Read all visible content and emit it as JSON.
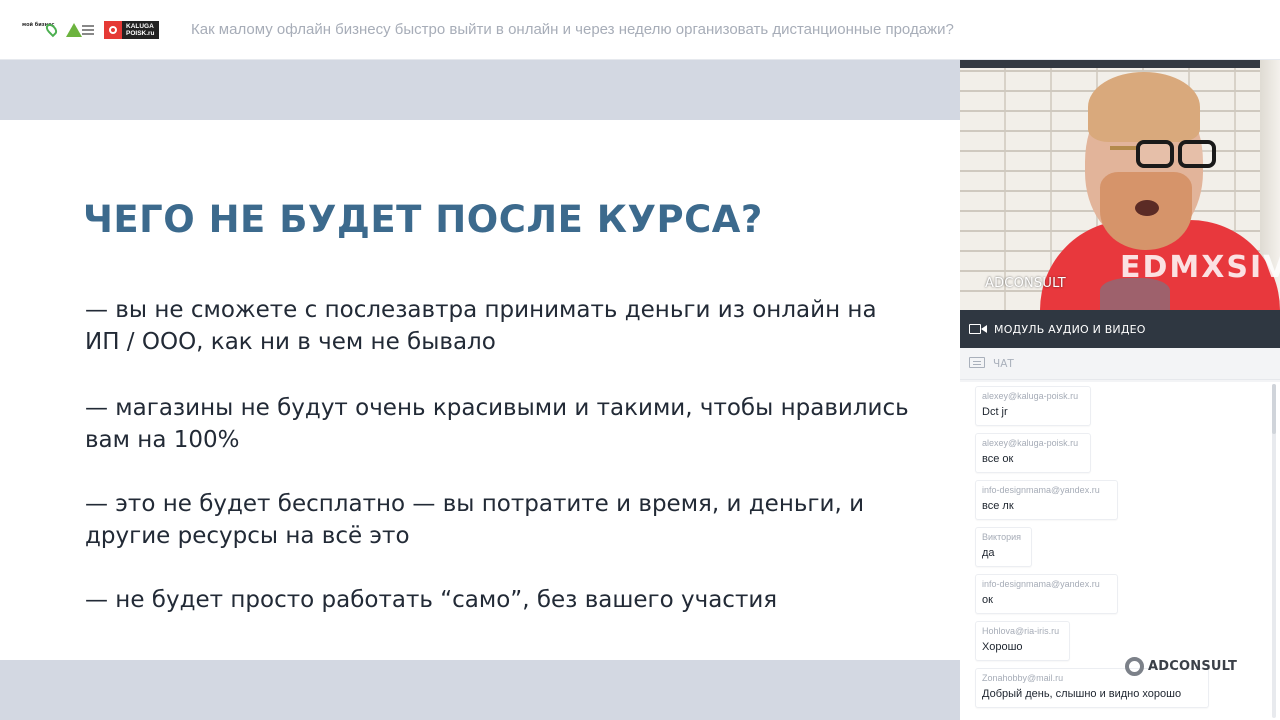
{
  "header": {
    "logos": {
      "moy_biznes": "мой бизнес",
      "kaluga_line1": "KALUGA",
      "kaluga_line2": "POISK.ru"
    },
    "title": "Как малому офлайн бизнесу быстро выйти в онлайн и через неделю организовать дистанционные продажи?"
  },
  "slide": {
    "title": "ЧЕГО НЕ БУДЕТ ПОСЛЕ КУРСА?",
    "points": [
      "— вы не сможете с послезавтра принимать деньги из онлайн на ИП / ООО, как ни в чем не бывало",
      "— магазины не будут очень красивыми и такими, чтобы нравились вам на 100%",
      "— это не будет бесплатно — вы потратите и время, и деньги, и другие ресурсы на всё это",
      "— не будет просто работать “само”, без вашего участия"
    ],
    "colors": {
      "title": "#3c6a8d",
      "text": "#222a36",
      "band": "#d3d8e2"
    }
  },
  "video": {
    "label": "ADCONSULT",
    "shirt_text": "EDMXSIV"
  },
  "module": {
    "label": "МОДУЛЬ АУДИО И ВИДЕО",
    "icon": "video-camera-icon"
  },
  "chat": {
    "label": "ЧАТ",
    "icon": "chat-icon",
    "messages": [
      {
        "author": "alexey@kaluga-poisk.ru",
        "text": "Dct jr"
      },
      {
        "author": "alexey@kaluga-poisk.ru",
        "text": "все ок"
      },
      {
        "author": "info-designmama@yandex.ru",
        "text": "все лк"
      },
      {
        "author": "Виктория",
        "text": "да"
      },
      {
        "author": "info-designmama@yandex.ru",
        "text": "ок"
      },
      {
        "author": "Hohlova@ria-iris.ru",
        "text": "Хорошо"
      },
      {
        "author": "Zonahobby@mail.ru",
        "text": "Добрый день, слышно и видно хорошо"
      }
    ]
  },
  "watermark": {
    "text": "ADCONSULT"
  }
}
